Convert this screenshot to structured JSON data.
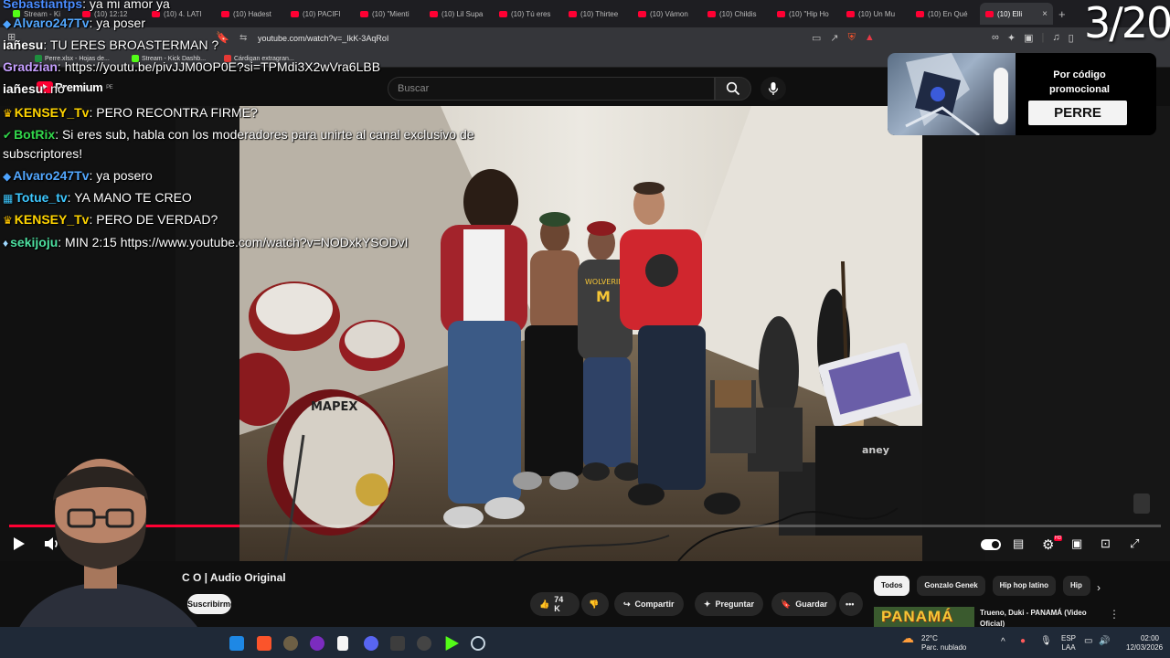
{
  "browser": {
    "tabs": [
      {
        "label": "Stream - Ki"
      },
      {
        "label": "(10) 12:12"
      },
      {
        "label": "(10) 4. LATI"
      },
      {
        "label": "(10) Hadest"
      },
      {
        "label": "(10) PACIFI"
      },
      {
        "label": "(10) \"Mienti"
      },
      {
        "label": "(10) Lil Supa"
      },
      {
        "label": "(10) Tú eres"
      },
      {
        "label": "(10) Thirtee"
      },
      {
        "label": "(10) Vámon"
      },
      {
        "label": "(10) Childis"
      },
      {
        "label": "(10) \"Hip Ho"
      },
      {
        "label": "(10) Un Mu"
      },
      {
        "label": "(10) En Qué"
      },
      {
        "label": "(10) Elli"
      }
    ],
    "url": "youtube.com/watch?v=_IkK-3AqRoI",
    "bookmarks": [
      {
        "label": "Perre.xlsx - Hojas de...",
        "color": "#1e8e3e"
      },
      {
        "label": "Stream - Kick Dashb...",
        "color": "#53fc18"
      },
      {
        "label": "Cárdigan extragran...",
        "color": "#e53935"
      }
    ]
  },
  "youtube": {
    "brand": "Premium",
    "region": "PE",
    "search_placeholder": "Buscar",
    "video_title": "C O | Audio Original",
    "subscribe_label": "Suscribirme",
    "likes": "74 K",
    "share_label": "Compartir",
    "ask_label": "Preguntar",
    "save_label": "Guardar",
    "chips": [
      "Todos",
      "Gonzalo Genek",
      "Hip hop latino",
      "Hip"
    ],
    "recommendation": {
      "thumb_text": "PANAMÁ",
      "title": "Trueno, Duki - PANAMÁ (Video Oficial)"
    },
    "progress": 0.2,
    "amp_label": "aney"
  },
  "promo": {
    "text": "Por código promocional",
    "code": "PERRE"
  },
  "counter": "3/20",
  "chat": [
    {
      "user": "Sebastiantps",
      "text": "ya mi amor ya",
      "color": "#4a8cff",
      "badge": "",
      "badge_color": ""
    },
    {
      "user": "Alvaro247Tv",
      "text": "ya poser",
      "color": "#53a8ff",
      "badge": "diamond",
      "badge_color": "#4ea4ff"
    },
    {
      "user": "iañesu",
      "text": "TU ERES BROASTERMAN ?",
      "color": "#ffffff",
      "badge": "",
      "badge_color": ""
    },
    {
      "user": "Gradzian",
      "text": "https://youtu.be/pivJJM0OP0E?si=TPMdi3X2wVra6LBB",
      "color": "#c6a0ff",
      "badge": "",
      "badge_color": ""
    },
    {
      "user": "iañesu",
      "text": "no",
      "color": "#ffffff",
      "badge": "",
      "badge_color": ""
    },
    {
      "user": "KENSEY_Tv",
      "text": "PERO RECONTRA FIRME?",
      "color": "#ffd400",
      "badge": "crown",
      "badge_color": "#ffc400"
    },
    {
      "user": "BotRix",
      "text": "Si eres sub, habla con los moderadores para unirte al canal exclusivo de",
      "color": "#32d74b",
      "badge": "check",
      "badge_color": "#32d74b"
    },
    {
      "user": "",
      "text": "subscriptores!",
      "color": "#ffffff",
      "badge": "",
      "badge_color": ""
    },
    {
      "user": "Alvaro247Tv",
      "text": "ya posero",
      "color": "#53a8ff",
      "badge": "diamond",
      "badge_color": "#4ea4ff"
    },
    {
      "user": "Totue_tv",
      "text": "YA MANO TE CREO",
      "color": "#3ec8ff",
      "badge": "grid",
      "badge_color": "#3ec8ff"
    },
    {
      "user": "KENSEY_Tv",
      "text": "PERO DE VERDAD?",
      "color": "#ffd400",
      "badge": "crown",
      "badge_color": "#ffc400"
    },
    {
      "user": "sekijoju",
      "text": "MIN 2:15 https://www.youtube.com/watch?v=NODxkYSODvI",
      "color": "#4de0a0",
      "badge": "gem",
      "badge_color": "#9fd8ff"
    }
  ],
  "taskbar": {
    "weather_temp": "22°C",
    "weather_desc": "Parc. nublado",
    "lang_top": "ESP",
    "lang_bottom": "LAA",
    "time": "02:00",
    "date": "12/03/2026"
  },
  "colors": {
    "accent": "#ff0033",
    "background": "#0f0f0f",
    "chip_bg": "#272727"
  }
}
